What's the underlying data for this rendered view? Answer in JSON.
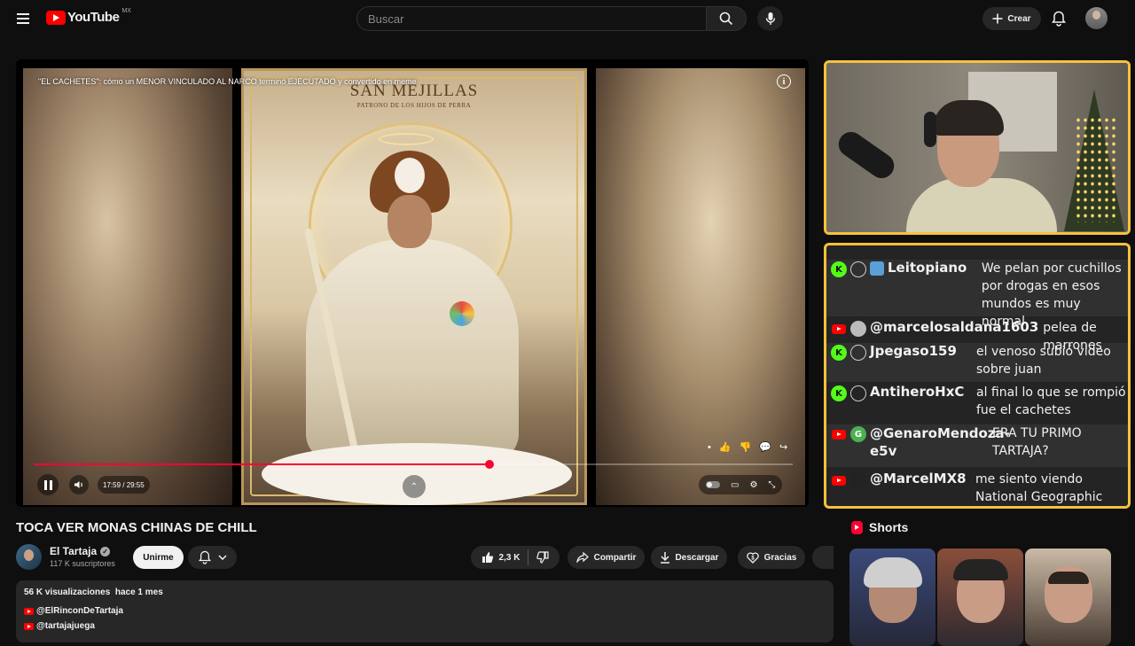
{
  "header": {
    "logo_text": "YouTube",
    "country_code": "MX",
    "search_placeholder": "Buscar",
    "create_label": "Crear"
  },
  "player": {
    "overlay_title": "\"EL CACHETES\": cómo un MENOR VINCULADO AL NARCO terminó EJECUTADO y convertido en meme",
    "card_title": "SAN MEJILLAS",
    "card_subtitle": "PATRONO DE LOS HIJOS DE PERRA",
    "current_time": "17:59",
    "duration": "29:55",
    "time_display": "17:59 / 29:55",
    "progress": 0.601,
    "accent_color": "#ff0033"
  },
  "chat": {
    "border_color": "#f6c13c",
    "messages": [
      {
        "platform": "kick",
        "user": "Leitopiano",
        "lines": [
          "We pelan por cuchillos",
          "por drogas en esos",
          "mundos es muy normal"
        ]
      },
      {
        "platform": "youtube",
        "user": "@marcelosaldana1603",
        "lines": [
          "pelea de marrones"
        ]
      },
      {
        "platform": "kick",
        "user": "Jpegaso159",
        "lines": [
          "el venoso subió video",
          "sobre juan"
        ]
      },
      {
        "platform": "kick",
        "user": "AntiheroHxC",
        "lines": [
          "al final lo que se rompió",
          "fue el cachetes"
        ]
      },
      {
        "platform": "youtube",
        "user_lines": [
          "@GenaroMendoza-",
          "e5v"
        ],
        "avatar_letter": "G",
        "lines": [
          "ERA TU PRIMO",
          "TARTAJA?"
        ]
      },
      {
        "platform": "youtube",
        "user": "@MarcelMX8",
        "lines": [
          "me siento viendo",
          "National Geographic"
        ]
      }
    ]
  },
  "video": {
    "title": "TOCA VER MONAS CHINAS DE CHILL",
    "channel_name": "El Tartaja",
    "subscribers": "117 K suscriptores",
    "join_label": "Unirme",
    "likes": "2,3 K",
    "share_label": "Compartir",
    "download_label": "Descargar",
    "thanks_label": "Gracias"
  },
  "description": {
    "views": "56 K visualizaciones",
    "date": "hace 1 mes",
    "links": [
      "@ElRinconDeTartaja",
      "@tartajajuega"
    ]
  },
  "shorts": {
    "heading": "Shorts"
  }
}
